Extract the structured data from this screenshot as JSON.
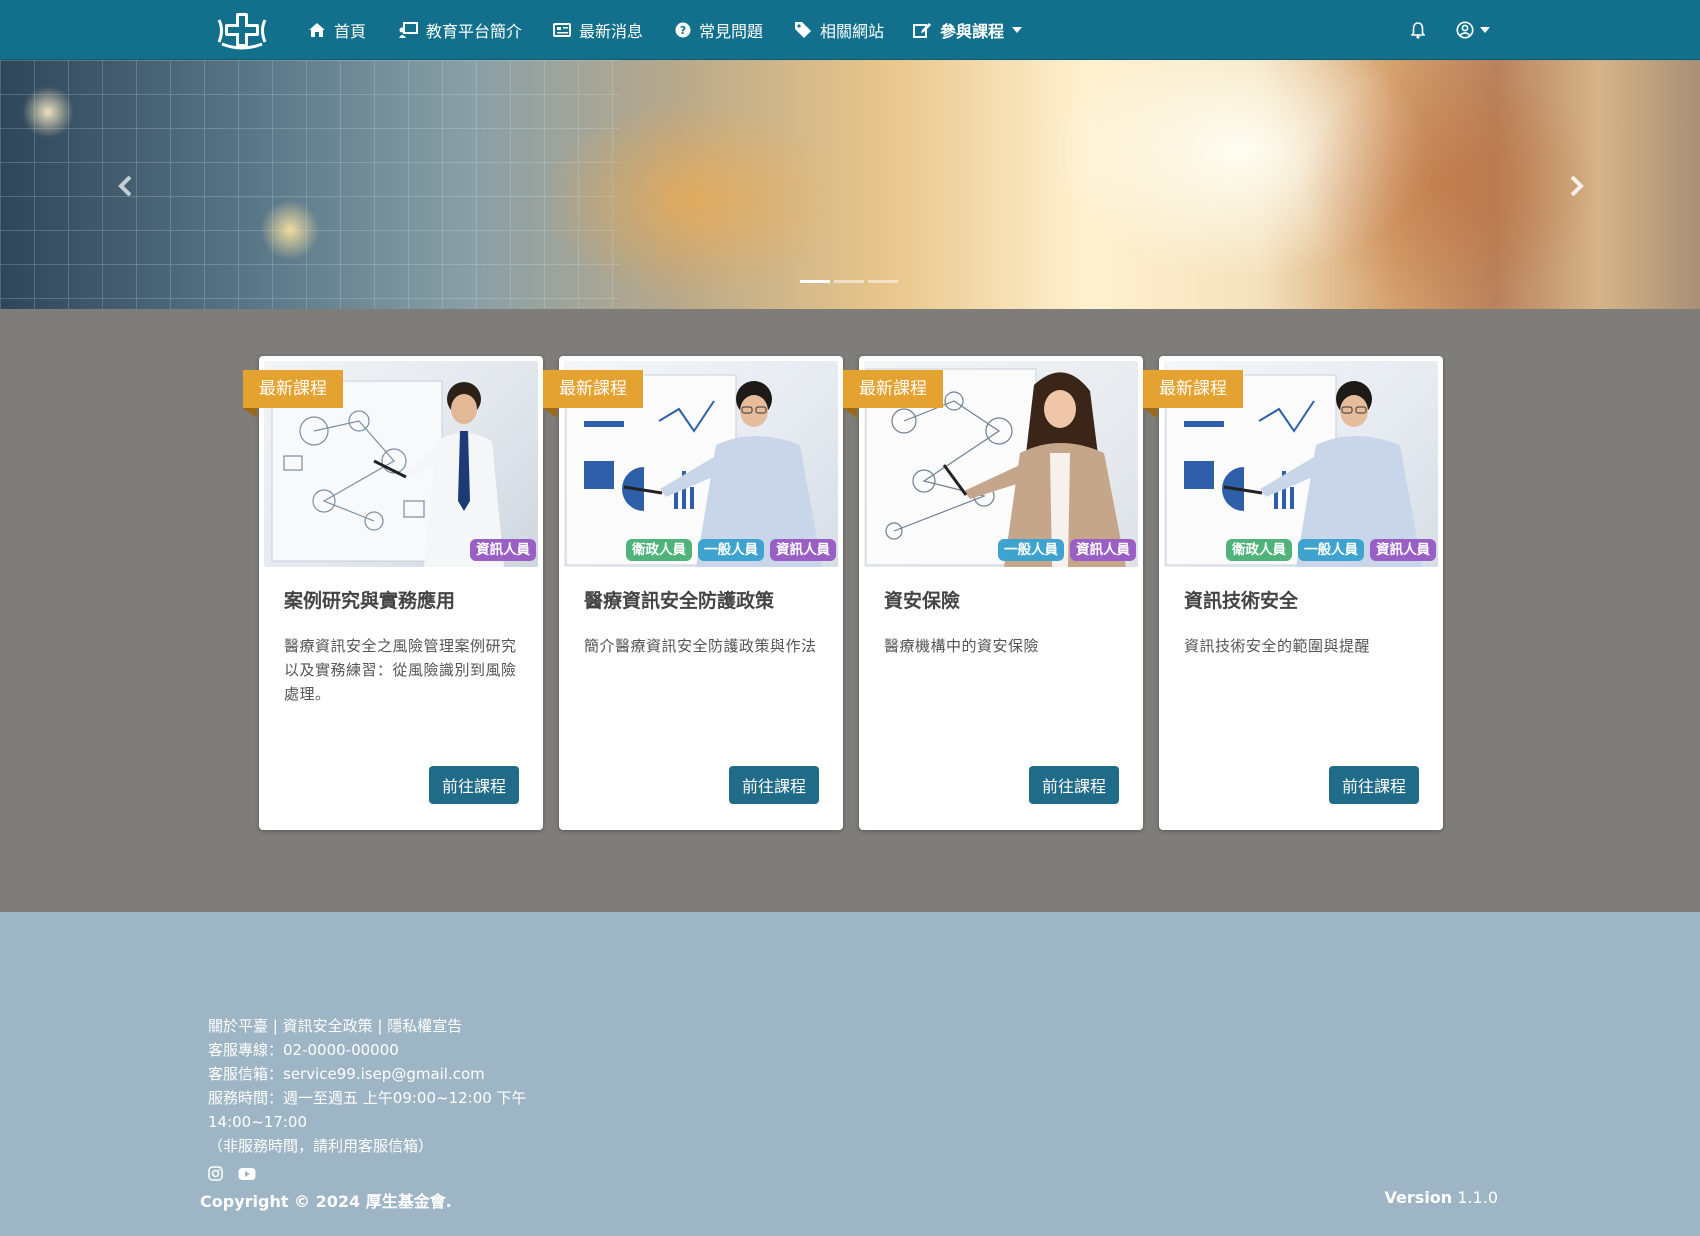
{
  "nav": {
    "items": [
      {
        "label": "首頁",
        "icon": "home-icon"
      },
      {
        "label": "教育平台簡介",
        "icon": "presentation-icon"
      },
      {
        "label": "最新消息",
        "icon": "newspaper-icon"
      },
      {
        "label": "常見問題",
        "icon": "question-circle-icon"
      },
      {
        "label": "相關網站",
        "icon": "tag-icon"
      },
      {
        "label": "參與課程",
        "icon": "edit-icon"
      }
    ],
    "bell_icon": "bell-icon",
    "user_icon": "user-circle-icon"
  },
  "hero": {
    "slides": 3,
    "active_slide": 1
  },
  "cards": [
    {
      "ribbon": "最新課程",
      "tags": [
        {
          "label": "資訊人員",
          "color": "purple"
        }
      ],
      "title": "案例研究與實務應用",
      "description": "醫療資訊安全之風險管理案例研究以及實務練習：從風險識別到風險處理。",
      "button": "前往課程"
    },
    {
      "ribbon": "最新課程",
      "tags": [
        {
          "label": "衛政人員",
          "color": "green"
        },
        {
          "label": "一般人員",
          "color": "blue"
        },
        {
          "label": "資訊人員",
          "color": "purple"
        }
      ],
      "title": "醫療資訊安全防護政策",
      "description": "簡介醫療資訊安全防護政策與作法",
      "button": "前往課程"
    },
    {
      "ribbon": "最新課程",
      "tags": [
        {
          "label": "一般人員",
          "color": "blue"
        },
        {
          "label": "資訊人員",
          "color": "purple"
        }
      ],
      "title": "資安保險",
      "description": "醫療機構中的資安保險",
      "button": "前往課程"
    },
    {
      "ribbon": "最新課程",
      "tags": [
        {
          "label": "衛政人員",
          "color": "green"
        },
        {
          "label": "一般人員",
          "color": "blue"
        },
        {
          "label": "資訊人員",
          "color": "purple"
        }
      ],
      "title": "資訊技術安全",
      "description": "資訊技術安全的範圍與提醒",
      "button": "前往課程"
    }
  ],
  "footer": {
    "links": [
      "關於平臺",
      "資訊安全政策",
      "隱私權宣告"
    ],
    "link_separator": " | ",
    "hotline": "客服專線：02-0000-00000",
    "email": "客服信箱：service99.isep@gmail.com",
    "hours": "服務時間：週一至週五 上午09:00~12:00 下午14:00~17:00",
    "note": "（非服務時間，請利用客服信箱）",
    "social": [
      "instagram-icon",
      "youtube-icon"
    ],
    "copyright": "Copyright © 2024 厚生基金會.",
    "version_label": "Version",
    "version_number": "1.1.0"
  },
  "colors": {
    "navbar": "#12708c",
    "ribbon": "#e4a230",
    "button": "#1f6b88",
    "tag_green": "#4fb37a",
    "tag_blue": "#3fa3cf",
    "tag_purple": "#9a5fc4",
    "footer": "#9db5c4",
    "page_bg": "#7e7d79"
  }
}
